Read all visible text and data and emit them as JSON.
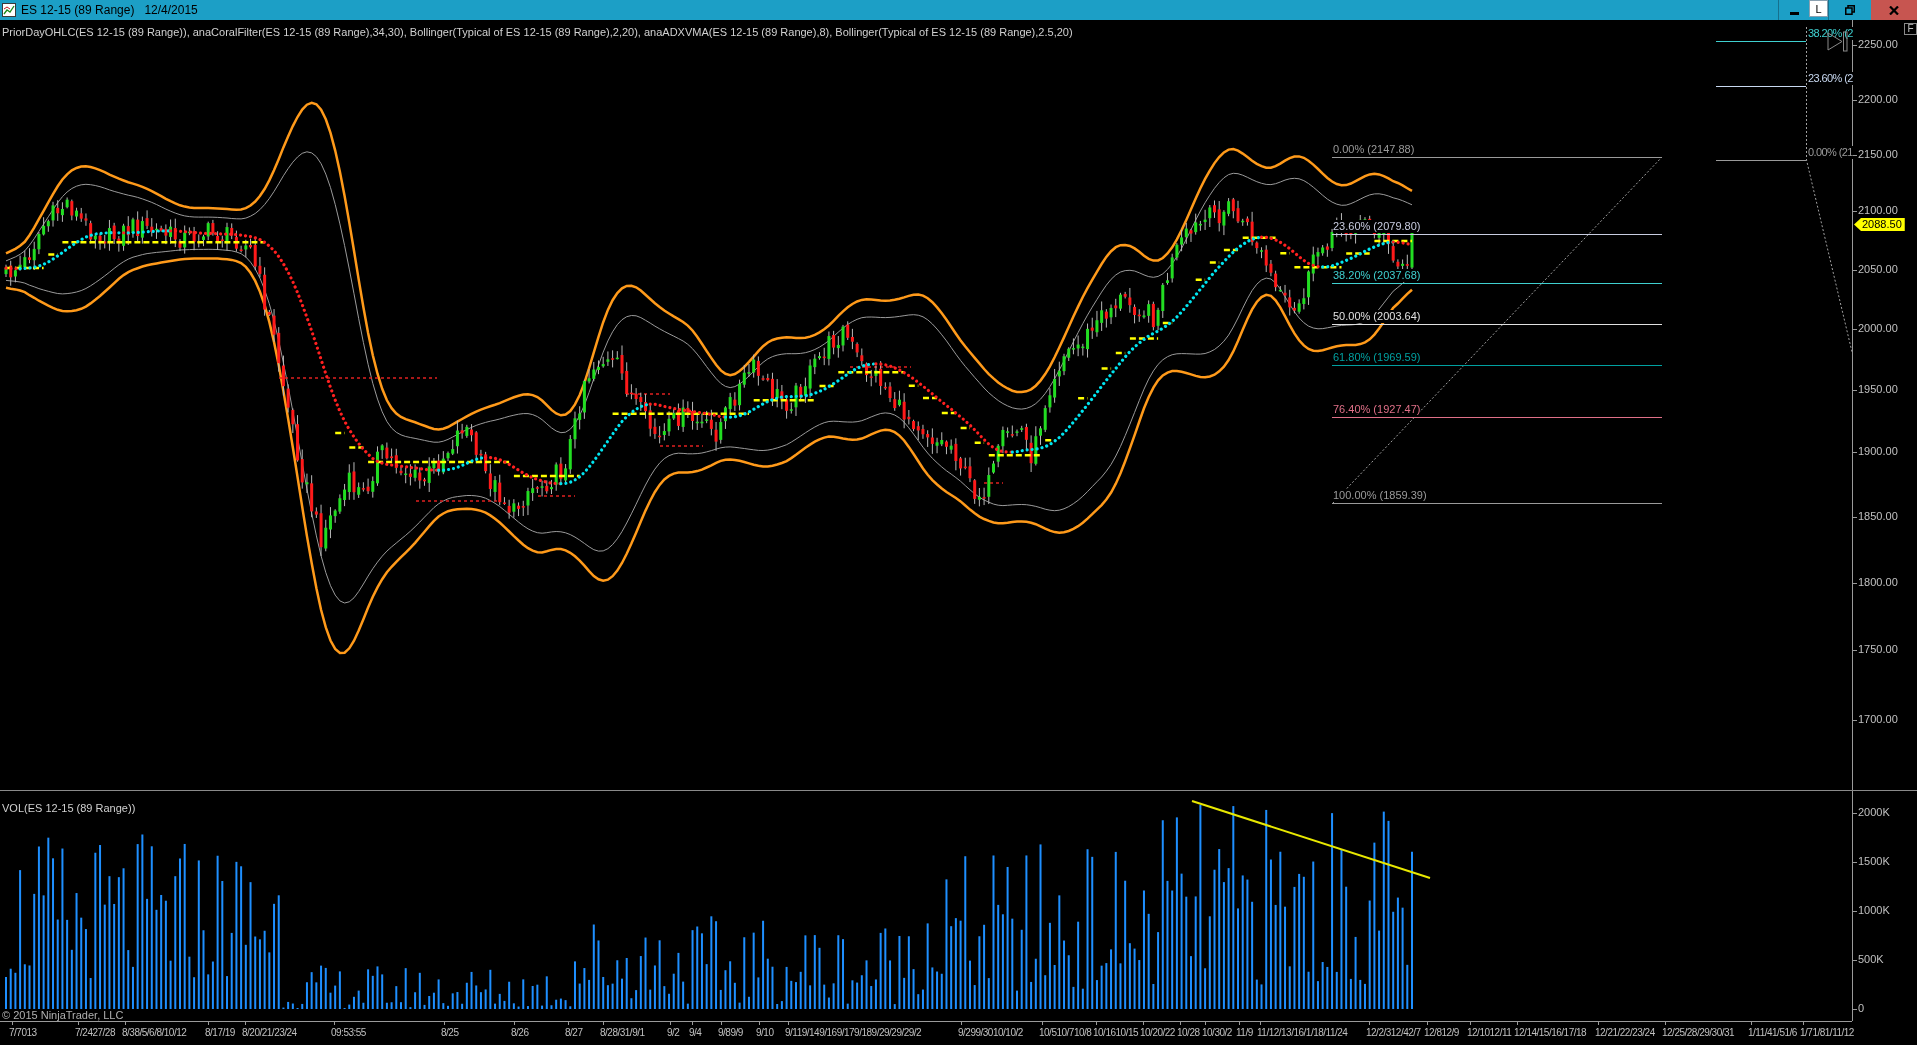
{
  "window": {
    "title": "ES 12-15 (89 Range)",
    "date": "12/4/2015",
    "button_label": "L"
  },
  "price_pane": {
    "legend": "PriorDayOHLC(ES 12-15 (89 Range)), anaCoralFilter(ES 12-15 (89 Range),34,30), Bollinger(Typical of ES 12-15 (89 Range),2,20), anaADXVMA(ES 12-15 (89 Range),8), Bollinger(Typical of ES 12-15 (89 Range),2.5,20)",
    "f_button": "F",
    "price_axis": [
      "2250.00",
      "2200.00",
      "2150.00",
      "2100.00",
      "2050.00",
      "2000.00",
      "1950.00",
      "1900.00",
      "1850.00",
      "1800.00",
      "1750.00",
      "1700.00"
    ],
    "last_price": "2088.50",
    "fib_retracement": [
      {
        "label": "0.00% (2147.88)",
        "color": "#9a9a9a"
      },
      {
        "label": "23.60% (2079.80)",
        "color": "#c8cce0"
      },
      {
        "label": "38.20% (2037.68)",
        "color": "#3fd0d0"
      },
      {
        "label": "50.00% (2003.64)",
        "color": "#e0e0e0"
      },
      {
        "label": "61.80% (1969.59)",
        "color": "#00a0a0"
      },
      {
        "label": "76.40% (1927.47)",
        "color": "#e07088"
      },
      {
        "label": "100.00% (1859.39)",
        "color": "#9a9a9a"
      }
    ],
    "fib_retracement_right": [
      {
        "label": "38.20% (2",
        "color": "#3fd0d0"
      },
      {
        "label": "23.60% (2",
        "color": "#c8d8f0"
      },
      {
        "label": "0.00% (21",
        "color": "#9a9a9a"
      }
    ]
  },
  "volume_pane": {
    "label": "VOL(ES 12-15 (89 Range))",
    "volume_axis": [
      "2000K",
      "1500K",
      "1000K",
      "500K",
      "0"
    ]
  },
  "copyright": "© 2015 NinjaTrader, LLC",
  "time_axis": [
    "7/7013",
    "7/2427/28",
    "8/38/5/6/8/10/12",
    "8/17/19",
    "8/20/21/23/24",
    "09:53:55",
    "8/25",
    "8/26",
    "8/27",
    "8/28/31/9/1",
    "9/2",
    "9/4",
    "9/89/9",
    "9/10",
    "9/119/149/169/179/189/29/29/29/2",
    "9/299/3010/10/2",
    "10/510/710/8",
    "10/1610/15",
    "10/20/22",
    "10/28",
    "10/30/2",
    "11/9",
    "11/12/13/16/1/18/11/24",
    "12/2/312/42/7",
    "12/812/9",
    "12/1012/11",
    "12/14/15/16/17/18",
    "12/21/22/23/24",
    "12/25/28/29/30/31",
    "1/11/41/51/6",
    "1/71/81/11/12"
  ]
}
